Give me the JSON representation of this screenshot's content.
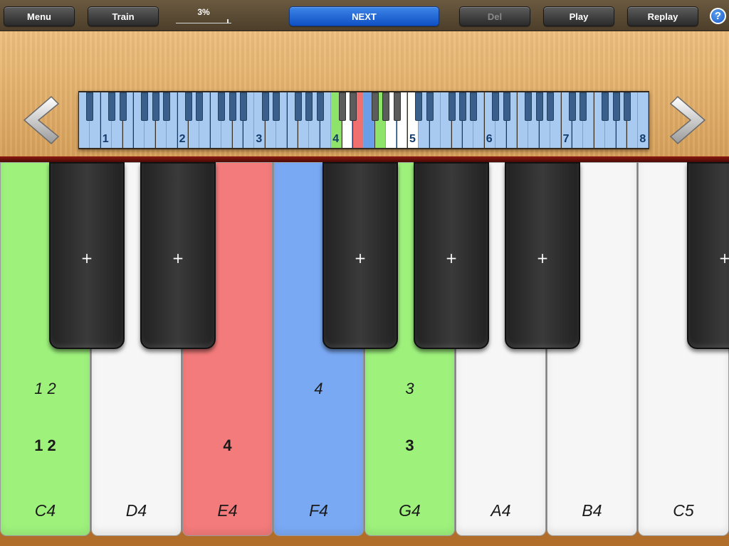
{
  "toolbar": {
    "menu_label": "Menu",
    "train_label": "Train",
    "progress_label": "3%",
    "progress_value": 0.03,
    "next_label": "NEXT",
    "del_label": "Del",
    "play_label": "Play",
    "replay_label": "Replay",
    "help_label": "?"
  },
  "mini_keyboard": {
    "octave_numbers": [
      "1",
      "2",
      "3",
      "4",
      "5",
      "6",
      "7",
      "8"
    ],
    "white_key_colors": {
      "default": "#a9caf0",
      "visible_range": "#ffffff",
      "C4": "#8ee36a",
      "E4": "#f07070",
      "F4": "#6a9ee8",
      "G4": "#8ee36a"
    }
  },
  "keyboard": {
    "white_keys": [
      {
        "note": "C4",
        "finger_italic": "1 2",
        "finger_bold": "1 2",
        "color": "#9ef27c"
      },
      {
        "note": "D4",
        "finger_italic": "",
        "finger_bold": "",
        "color": "#f6f6f6"
      },
      {
        "note": "E4",
        "finger_italic": "",
        "finger_bold": "4",
        "color": "#f47b7b"
      },
      {
        "note": "F4",
        "finger_italic": "4",
        "finger_bold": "",
        "color": "#7aa9f4"
      },
      {
        "note": "G4",
        "finger_italic": "3",
        "finger_bold": "3",
        "color": "#9ef27c"
      },
      {
        "note": "A4",
        "finger_italic": "",
        "finger_bold": "",
        "color": "#f6f6f6"
      },
      {
        "note": "B4",
        "finger_italic": "",
        "finger_bold": "",
        "color": "#f6f6f6"
      },
      {
        "note": "C5",
        "finger_italic": "",
        "finger_bold": "",
        "color": "#f6f6f6"
      }
    ],
    "black_key_label": "+"
  }
}
